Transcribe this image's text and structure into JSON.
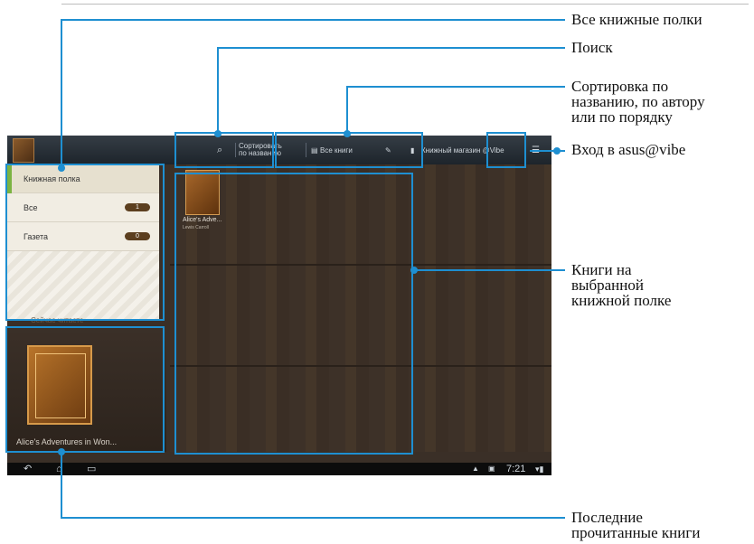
{
  "callouts": {
    "all_shelves": "Все книжные полки",
    "search": "Поиск",
    "sort": "Сортировка по\nназванию, по автору\nили по порядку",
    "login": "Вход в asus@vibe",
    "books_on_shelf": "Книги на\nвыбранной\nкнижной полке",
    "recent": "Последние\nпрочитанные книги"
  },
  "actionbar": {
    "search_icon": "search-icon",
    "sort_label": "Сортировать по названию",
    "all_books_label": "Все книги",
    "store_label": "Книжный магазин @Vibe",
    "menu_icon": "menu-icon"
  },
  "shelves": {
    "items": [
      {
        "label": "Книжная полка",
        "selected": true
      },
      {
        "label": "Все",
        "count": "1"
      },
      {
        "label": "Газета",
        "count": "0"
      }
    ]
  },
  "recent": {
    "header": "Сейчас читаете",
    "title": "Alice's Adventures in Won..."
  },
  "shelf_books": [
    {
      "title": "Alice's Adve...",
      "author": "Lewis Carroll"
    }
  ],
  "navbar": {
    "time": "7:21"
  },
  "colors": {
    "callout": "#1e8fd1",
    "accent": "#7cb342",
    "wood": "#3d3128"
  }
}
